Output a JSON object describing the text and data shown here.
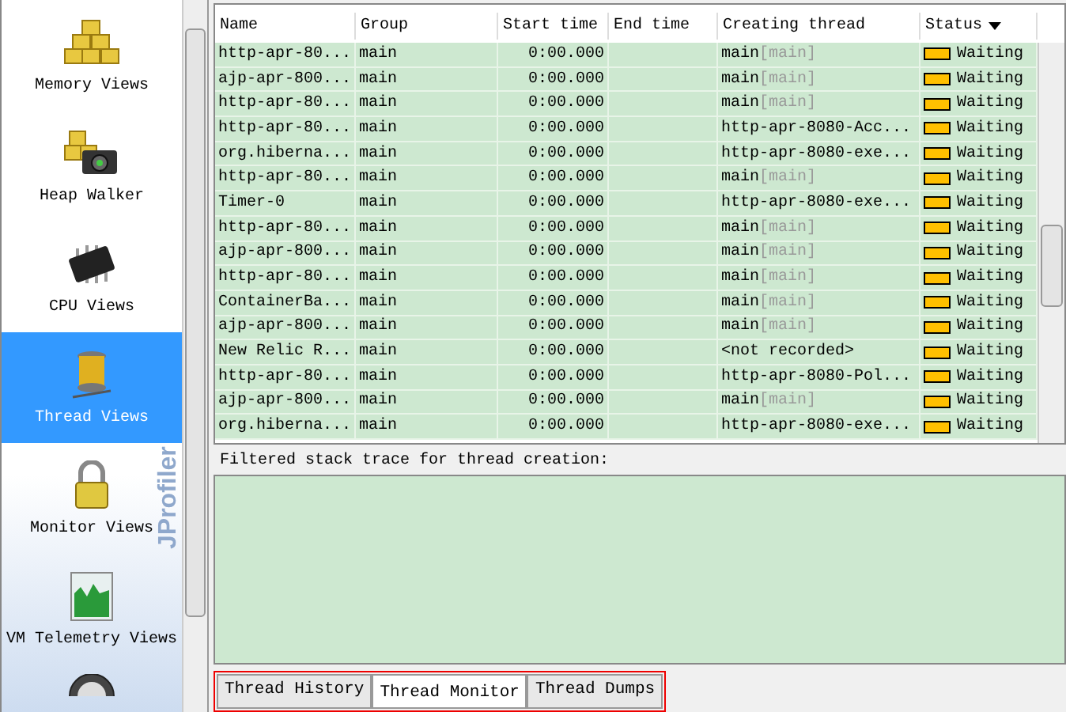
{
  "sidebar": {
    "brand": "JProfiler",
    "items": [
      {
        "label": "Memory Views",
        "kind": "memory",
        "selected": false
      },
      {
        "label": "Heap Walker",
        "kind": "heap",
        "selected": false
      },
      {
        "label": "CPU Views",
        "kind": "cpu",
        "selected": false
      },
      {
        "label": "Thread Views",
        "kind": "thread",
        "selected": true
      },
      {
        "label": "Monitor Views",
        "kind": "monitor",
        "selected": false
      },
      {
        "label": "VM Telemetry Views",
        "kind": "telemetry",
        "selected": false
      },
      {
        "kind": "gauge",
        "selected": false
      }
    ]
  },
  "table": {
    "columns": [
      "Name",
      "Group",
      "Start time",
      "End time",
      "Creating thread",
      "Status"
    ],
    "rows": [
      {
        "name": "http-apr-80...",
        "group": "main",
        "start": "0:00.000",
        "creator": "main",
        "creator_group": "[main]",
        "status": "Waiting"
      },
      {
        "name": "ajp-apr-800...",
        "group": "main",
        "start": "0:00.000",
        "creator": "main",
        "creator_group": "[main]",
        "status": "Waiting"
      },
      {
        "name": "http-apr-80...",
        "group": "main",
        "start": "0:00.000",
        "creator": "main",
        "creator_group": "[main]",
        "status": "Waiting"
      },
      {
        "name": "http-apr-80...",
        "group": "main",
        "start": "0:00.000",
        "creator": "http-apr-8080-Acc...",
        "status": "Waiting"
      },
      {
        "name": "org.hiberna...",
        "group": "main",
        "start": "0:00.000",
        "creator": "http-apr-8080-exe...",
        "status": "Waiting"
      },
      {
        "name": "http-apr-80...",
        "group": "main",
        "start": "0:00.000",
        "creator": "main",
        "creator_group": "[main]",
        "status": "Waiting"
      },
      {
        "name": "Timer-0",
        "group": "main",
        "start": "0:00.000",
        "creator": "http-apr-8080-exe...",
        "status": "Waiting"
      },
      {
        "name": "http-apr-80...",
        "group": "main",
        "start": "0:00.000",
        "creator": "main",
        "creator_group": "[main]",
        "status": "Waiting"
      },
      {
        "name": "ajp-apr-800...",
        "group": "main",
        "start": "0:00.000",
        "creator": "main",
        "creator_group": "[main]",
        "status": "Waiting"
      },
      {
        "name": "http-apr-80...",
        "group": "main",
        "start": "0:00.000",
        "creator": "main",
        "creator_group": "[main]",
        "status": "Waiting"
      },
      {
        "name": "ContainerBa...",
        "group": "main",
        "start": "0:00.000",
        "creator": "main",
        "creator_group": "[main]",
        "status": "Waiting"
      },
      {
        "name": "ajp-apr-800...",
        "group": "main",
        "start": "0:00.000",
        "creator": "main",
        "creator_group": "[main]",
        "status": "Waiting"
      },
      {
        "name": "New Relic R...",
        "group": "main",
        "start": "0:00.000",
        "creator": "<not recorded>",
        "status": "Waiting"
      },
      {
        "name": "http-apr-80...",
        "group": "main",
        "start": "0:00.000",
        "creator": "http-apr-8080-Pol...",
        "status": "Waiting"
      },
      {
        "name": "ajp-apr-800...",
        "group": "main",
        "start": "0:00.000",
        "creator": "main",
        "creator_group": "[main]",
        "status": "Waiting"
      },
      {
        "name": "org.hiberna...",
        "group": "main",
        "start": "0:00.000",
        "creator": "http-apr-8080-exe...",
        "status": "Waiting"
      }
    ]
  },
  "stack_trace": {
    "label": "Filtered stack trace for thread creation:"
  },
  "tabs": [
    {
      "label": "Thread History",
      "selected": false
    },
    {
      "label": "Thread Monitor",
      "selected": true
    },
    {
      "label": "Thread Dumps",
      "selected": false
    }
  ]
}
